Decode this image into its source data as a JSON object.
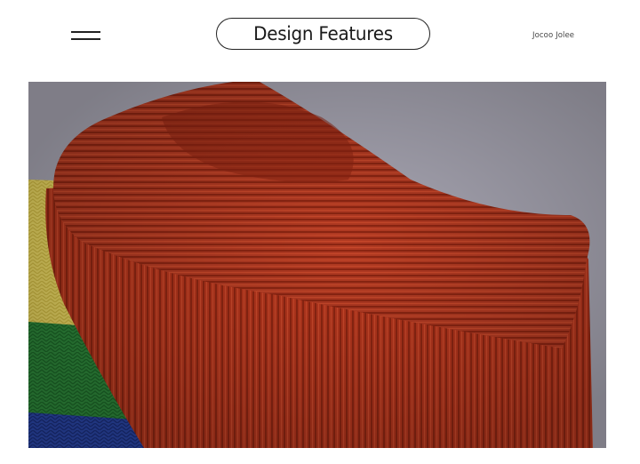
{
  "header": {
    "menu_icon": "hamburger-menu-icon",
    "title": "Design Features",
    "brand": "Jocoo Jolee"
  },
  "product_image": {
    "subject": "sweater-collar-closeup",
    "colors": {
      "background": "#a9a7b4",
      "collar_red": "#b5361d",
      "stripe_yellow": "#eedc6a",
      "stripe_green": "#2f8a3c",
      "stripe_blue": "#2a46a8"
    }
  }
}
